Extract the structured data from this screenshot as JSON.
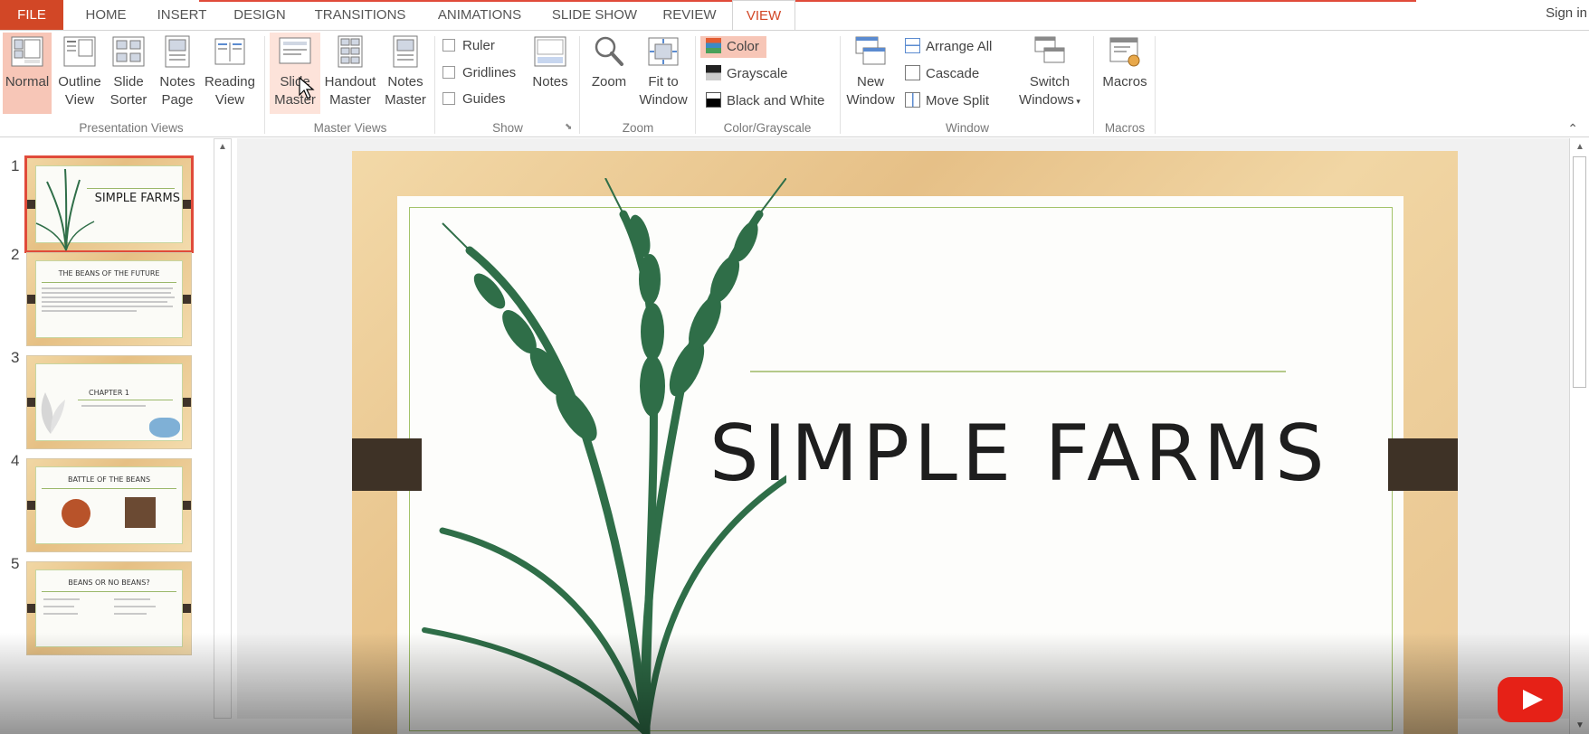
{
  "tabs": {
    "file": "FILE",
    "home": "HOME",
    "insert": "INSERT",
    "design": "DESIGN",
    "transitions": "TRANSITIONS",
    "animations": "ANIMATIONS",
    "slide_show": "SLIDE SHOW",
    "review": "REVIEW",
    "view": "VIEW",
    "active": "VIEW"
  },
  "signin": "Sign in",
  "ribbon": {
    "presentation_views": {
      "label": "Presentation Views",
      "normal": "Normal",
      "outline_1": "Outline",
      "outline_2": "View",
      "sorter_1": "Slide",
      "sorter_2": "Sorter",
      "notes_1": "Notes",
      "notes_2": "Page",
      "reading_1": "Reading",
      "reading_2": "View",
      "selected": "Normal"
    },
    "master_views": {
      "label": "Master Views",
      "slide_1": "Slide",
      "slide_2": "Master",
      "handout_1": "Handout",
      "handout_2": "Master",
      "notes_1": "Notes",
      "notes_2": "Master"
    },
    "show": {
      "label": "Show",
      "ruler": "Ruler",
      "gridlines": "Gridlines",
      "guides": "Guides",
      "notes": "Notes"
    },
    "zoom": {
      "label": "Zoom",
      "zoom": "Zoom",
      "fit_1": "Fit to",
      "fit_2": "Window"
    },
    "color": {
      "label": "Color/Grayscale",
      "color": "Color",
      "grayscale": "Grayscale",
      "bw": "Black and White",
      "selected": "Color"
    },
    "window": {
      "label": "Window",
      "new_1": "New",
      "new_2": "Window",
      "arrange": "Arrange All",
      "cascade": "Cascade",
      "move_split": "Move Split",
      "switch_1": "Switch",
      "switch_2": "Windows"
    },
    "macros": {
      "label": "Macros",
      "macros": "Macros"
    }
  },
  "slides": [
    {
      "num": "1",
      "title": "SIMPLE FARMS",
      "selected": true
    },
    {
      "num": "2",
      "title": "THE BEANS OF THE FUTURE"
    },
    {
      "num": "3",
      "title": "CHAPTER 1"
    },
    {
      "num": "4",
      "title": "BATTLE OF THE BEANS"
    },
    {
      "num": "5",
      "title": "BEANS OR NO BEANS?"
    }
  ],
  "current_slide": {
    "title": "SIMPLE FARMS"
  },
  "colors": {
    "accent": "#d24726",
    "selection": "#f7c6b7",
    "wheat_green": "#2f6e48",
    "clip_brown": "#3e3226"
  }
}
